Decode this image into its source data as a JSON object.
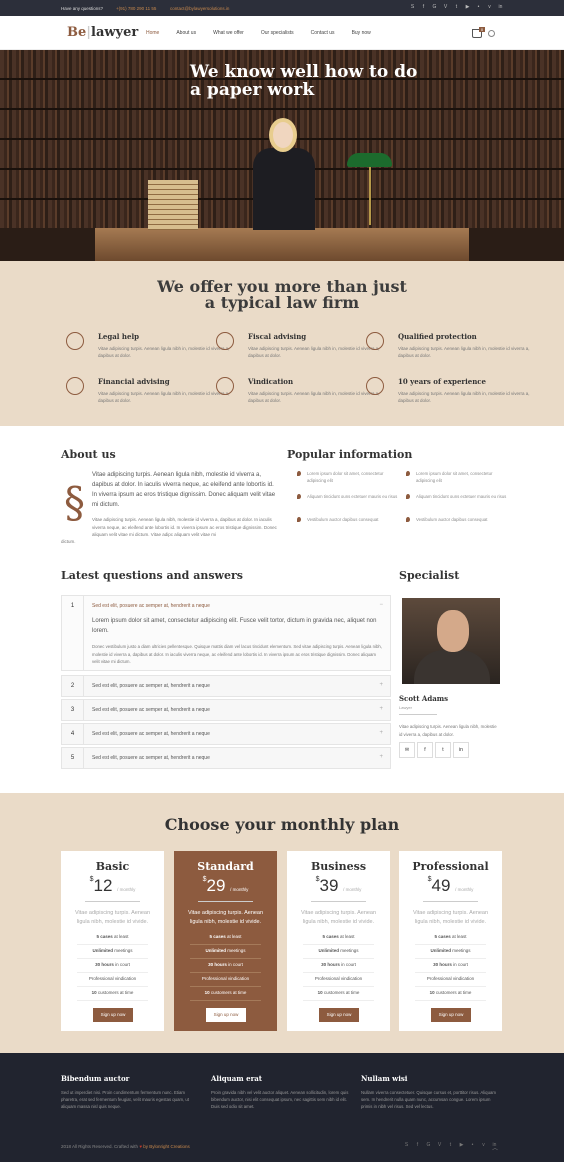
{
  "topbar": {
    "question": "Have any questions?",
    "phone": "+(91) 780 290 11 55",
    "email": "contact@bylawyersolutions.in",
    "social": [
      "skype-icon",
      "facebook-icon",
      "google-plus-icon",
      "vimeo-icon",
      "twitter-icon",
      "youtube-icon",
      "flickr-icon",
      "vk-icon",
      "linkedin-icon"
    ]
  },
  "nav": {
    "logo_a": "Be",
    "logo_b": "lawyer",
    "items": [
      "Home",
      "About us",
      "What we offer",
      "Our specialists",
      "Contact us",
      "Buy now"
    ],
    "cart_count": "0"
  },
  "hero": {
    "line1": "We know well how to do",
    "line2": "a paper work"
  },
  "offer": {
    "title1": "We offer you more than just",
    "title2": "a typical law firm",
    "features": [
      {
        "title": "Legal help",
        "desc": "Vitae adipiscing turpis. Aenean ligula nibh in, molestie id viverra a, dapibus at dolor."
      },
      {
        "title": "Fiscal advising",
        "desc": "Vitae adipiscing turpis. Aenean ligula nibh in, molestie id viverra a, dapibus at dolor."
      },
      {
        "title": "Qualified protection",
        "desc": "Vitae adipiscing turpis. Aenean ligula nibh in, molestie id viverra a, dapibus at dolor."
      },
      {
        "title": "Financial advising",
        "desc": "Vitae adipiscing turpis. Aenean ligula nibh in, molestie id viverra a, dapibus at dolor."
      },
      {
        "title": "Vindication",
        "desc": "Vitae adipiscing turpis. Aenean ligula nibh in, molestie id viverra a, dapibus at dolor."
      },
      {
        "title": "10 years of experience",
        "desc": "Vitae adipiscing turpis. Aenean ligula nibh in, molestie id viverra a, dapibus at dolor."
      }
    ]
  },
  "about": {
    "title": "About us",
    "p1": "Vitae adipiscing turpis. Aenean ligula nibh, molestie id viverra a, dapibus at dolor. In iaculis viverra neque, ac eleifend ante lobortis id. In viverra ipsum ac eros tristique dignissim. Donec aliquam velit vitae mi dictum.",
    "p2": "Vitae adipiscing turpis. Aenean ligula nibh, molestie id viverra a, dapibus at dolor. In iaculis viverra neque, ac eleifend ante lobortis id. In viverra ipsum ac eros tristique dignissim. Donec aliquam velit vitae mi dictum. Vitae adipc aliquam velit vitae mi",
    "p3": "dictum."
  },
  "popular": {
    "title": "Popular information",
    "items": [
      "Lorem ipsum dolor sit amet, consectetur adipiscing elit",
      "Lorem ipsum dolor sit amet, consectetur adipiscing elit",
      "Aliquam tincidunt ouns ectetuer mauris eu risus",
      "Aliquam tincidunt ouns ectetuer mauris eu risus",
      "Vestibulum auctor dapibus consequat",
      "Vestibulum auctor dapibus consequat"
    ]
  },
  "faq": {
    "title": "Latest questions and answers",
    "rows": [
      {
        "n": "1",
        "q": "Sed est elit, posuere ac semper at, hendrerit a neque",
        "sign": "−"
      },
      {
        "n": "2",
        "q": "Sed est elit, posuere ac semper at, hendrerit a neque",
        "sign": "+"
      },
      {
        "n": "3",
        "q": "Sed est elit, posuere ac semper at, hendrerit a neque",
        "sign": "+"
      },
      {
        "n": "4",
        "q": "Sed est elit, posuere ac semper at, hendrerit a neque",
        "sign": "+"
      },
      {
        "n": "5",
        "q": "Sed est elit, posuere ac semper at, hendrerit a neque",
        "sign": "+"
      }
    ],
    "answer": "Lorem ipsum dolor sit amet, consectetur adipiscing elit. Fusce velit tortor, dictum in gravida nec, aliquet non lorem.",
    "answer2": "Donec vestibulum justo a diam ultricies pellentesque. Quisque mattis diam vel lacus tincidunt elementum. Sed vitae adipiscing turpis. Aenean ligula nibh, molestie id viverra a, dapibus at dolor. In iaculis viverra neque, ac eleifend ante lobortis id. In viverra ipsum ac eros tristique dignissim. Donec aliquam velit vitae mi dictum."
  },
  "specialist": {
    "title": "Specialist",
    "name": "Scott Adams",
    "role": "Lawyer",
    "desc": "Vitae adipiscing turpis. Aenean ligula nibh, molestie id viverra a, dapibus at dolor.",
    "social": [
      "✉",
      "f",
      "t",
      "in"
    ]
  },
  "plans": {
    "title": "Choose your monthly plan",
    "currency": "$",
    "per": "/ monthly",
    "desc": "Vitae adipiscing turpis. Aenean ligula nibh, molestie id vivide.",
    "button": "Sign up now",
    "cards": [
      {
        "name": "Basic",
        "price": "12",
        "featured": false
      },
      {
        "name": "Standard",
        "price": "29",
        "featured": true
      },
      {
        "name": "Business",
        "price": "39",
        "featured": false
      },
      {
        "name": "Professional",
        "price": "49",
        "featured": false
      }
    ],
    "features": [
      {
        "bold": "5 cases",
        "rest": " at least"
      },
      {
        "bold": "Unlimited",
        "rest": " meetings"
      },
      {
        "bold": "30 hours",
        "rest": " in court"
      },
      {
        "bold": "",
        "rest": "Professional vindication"
      },
      {
        "bold": "10",
        "rest": " customers at time"
      }
    ]
  },
  "footer": {
    "cols": [
      {
        "title": "Bibendum auctor",
        "desc": "Sed ut imperdiet nisi. Proin condimentum fermentum nunc. Etiam pharetra, erat sed fermentum feugiat, velit mauris egestas quam, ut aliquam massa nisl quis neque."
      },
      {
        "title": "Aliquam erat",
        "desc": "Proin gravida nibh vel velit auctor aliquet. Aenean sollicitudin, lorem quis bibendum auctor, nisi elit consequat ipsum, nec sagittis sem nibh id elit. Duis sed odio sit amet."
      },
      {
        "title": "Nullam wisi",
        "desc": "Nullam viverra consectetuer. Quisque cursus et, porttitor risus. Aliquam sem. In hendrerit nulla quam nunc, accumsan congue. Lorem ipsum primis in nibh vel risus. Sed vel lectus."
      }
    ],
    "copy": "2018 All Rights Reserved. Crafted with",
    "heart": "♥",
    "by": "by Bylonright Creations",
    "social": [
      "skype-icon",
      "facebook-icon",
      "google-plus-icon",
      "vimeo-icon",
      "twitter-icon",
      "youtube-icon",
      "flickr-icon",
      "vk-icon",
      "linkedin-icon"
    ],
    "up": "︿"
  }
}
